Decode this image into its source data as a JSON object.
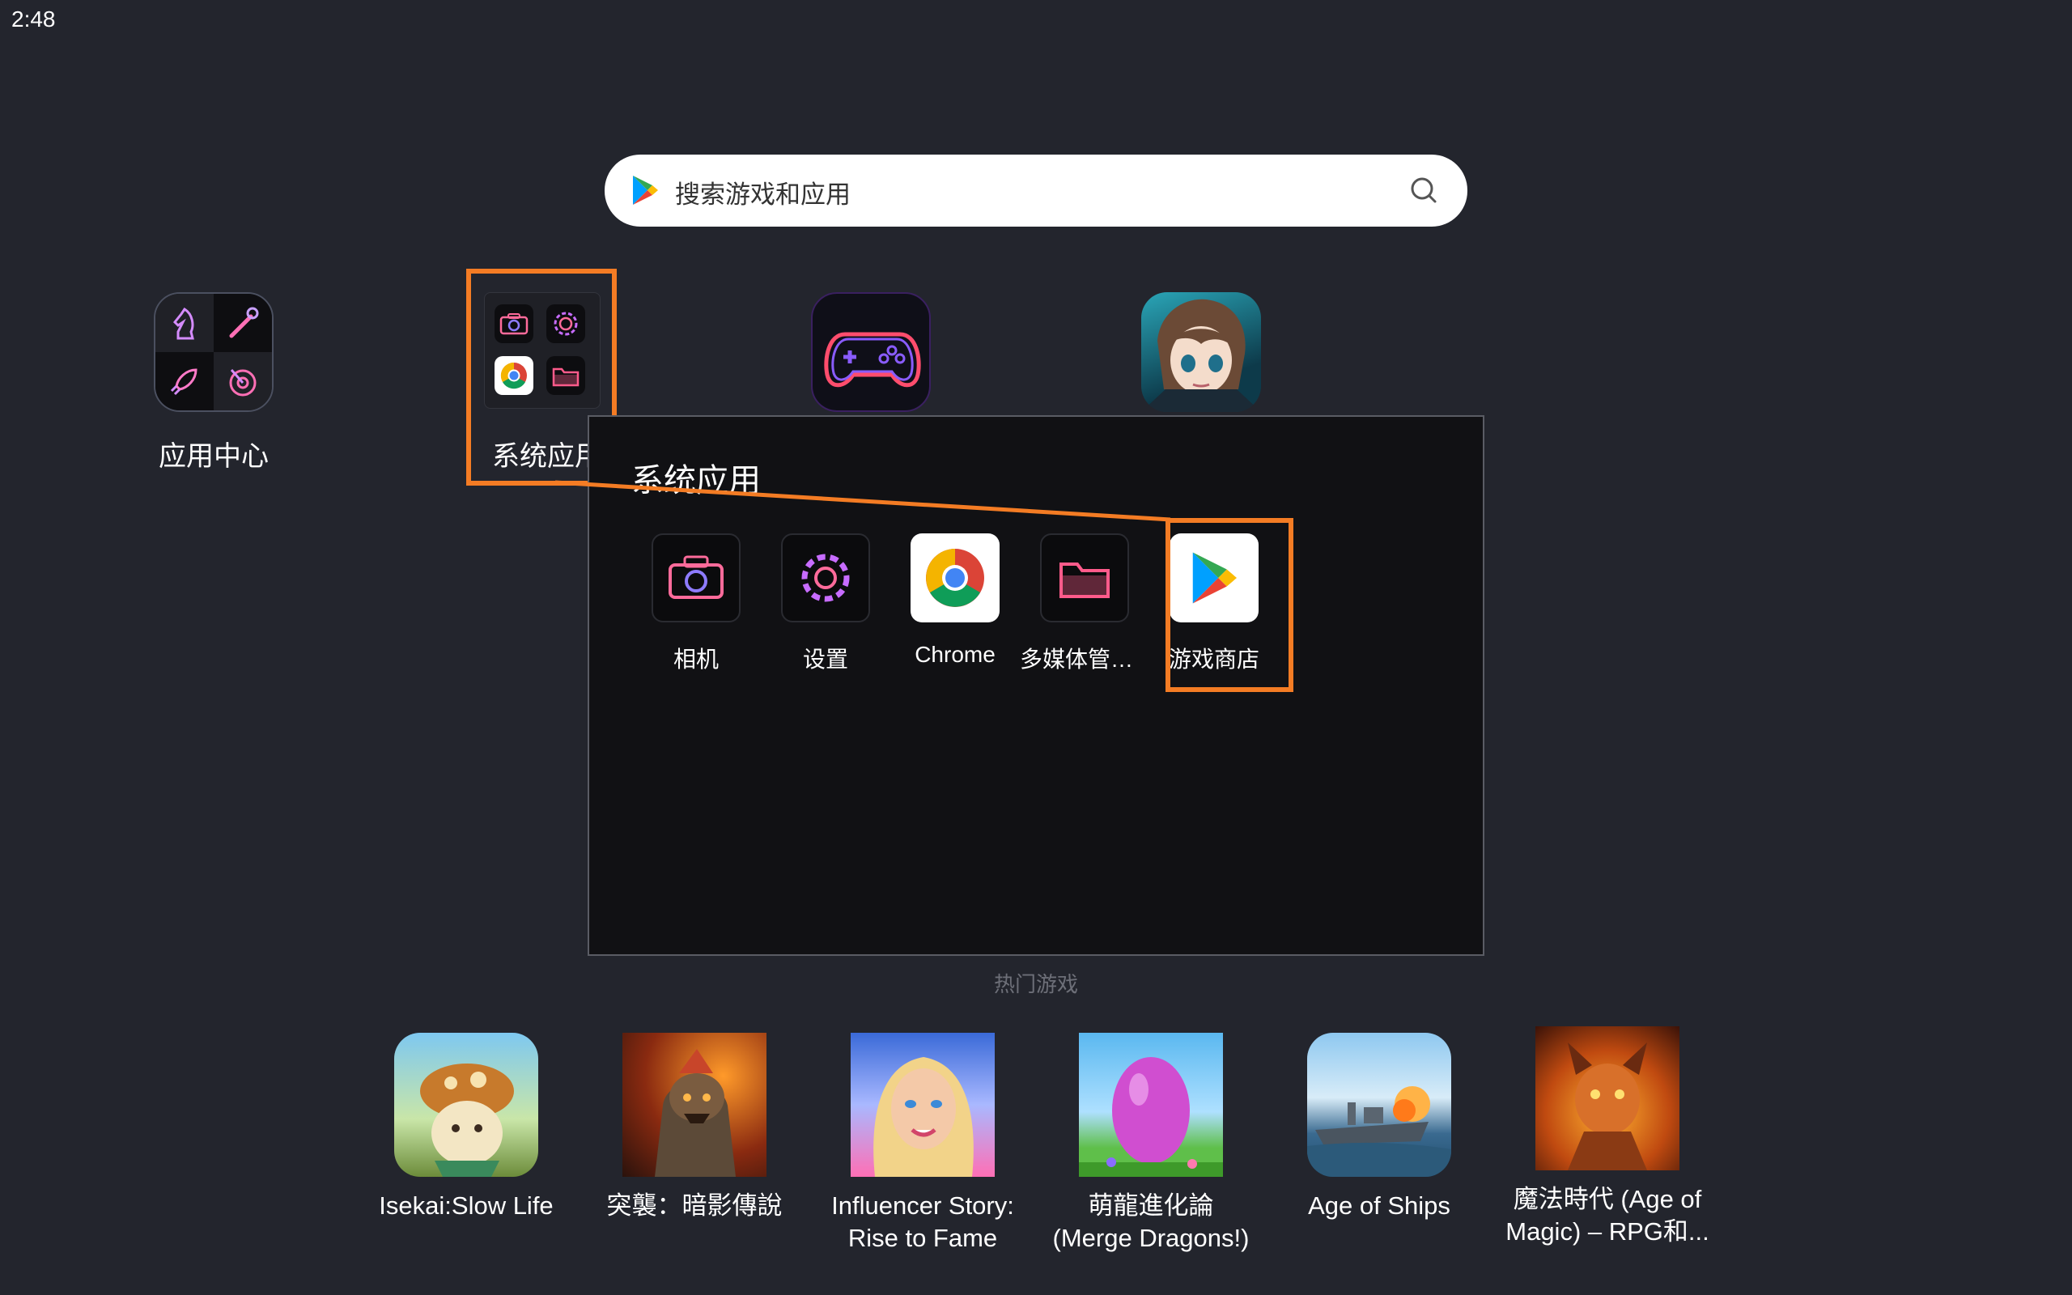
{
  "status_bar": {
    "time": "2:48"
  },
  "search": {
    "placeholder": "搜索游戏和应用",
    "icon": "search-icon",
    "logo": "google-play-logo"
  },
  "desktop": {
    "app_center": {
      "label": "应用中心"
    },
    "system_apps_folder": {
      "label": "系统应用"
    },
    "game_controller_app": {
      "label": ""
    },
    "anime_game_app": {
      "label": ""
    }
  },
  "folder": {
    "title": "系统应用",
    "apps": [
      {
        "label": "相机",
        "icon": "camera-icon"
      },
      {
        "label": "设置",
        "icon": "gear-icon"
      },
      {
        "label": "Chrome",
        "icon": "chrome-icon"
      },
      {
        "label": "多媒体管理...",
        "icon": "folder-icon"
      },
      {
        "label": "游戏商店",
        "icon": "google-play-icon"
      }
    ]
  },
  "hot_games": {
    "title": "热门游戏",
    "items": [
      {
        "line1": "Isekai:Slow Life",
        "line2": ""
      },
      {
        "line1": "突襲：暗影傳說",
        "line2": ""
      },
      {
        "line1": "Influencer Story:",
        "line2": "Rise to Fame"
      },
      {
        "line1": "萌龍進化論",
        "line2": "(Merge Dragons!)"
      },
      {
        "line1": "Age of Ships",
        "line2": ""
      },
      {
        "line1": "魔法時代 (Age of",
        "line2": "Magic) – RPG和..."
      }
    ]
  },
  "colors": {
    "background": "#23252d",
    "highlight": "#f47c24",
    "panel": "#111114"
  }
}
